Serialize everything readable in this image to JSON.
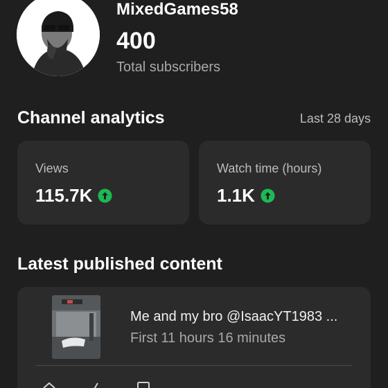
{
  "channel": {
    "name": "MixedGames58",
    "subscriber_count": "400",
    "subscriber_label": "Total subscribers",
    "avatar_icon": "avatar-icon"
  },
  "analytics": {
    "title": "Channel analytics",
    "period": "Last 28 days",
    "cards": [
      {
        "label": "Views",
        "value": "115.7K",
        "trend_icon": "arrow-up-circle-icon",
        "trend_color": "#1db954"
      },
      {
        "label": "Watch time (hours)",
        "value": "1.1K",
        "trend_icon": "arrow-up-circle-icon",
        "trend_color": "#1db954"
      }
    ]
  },
  "latest": {
    "title": "Latest published content",
    "video": {
      "title": "Me and my bro @IsaacYT1983 ...",
      "subtitle": "First 11 hours 16 minutes",
      "stats": [
        {
          "icon": "views-icon",
          "value": ""
        },
        {
          "icon": "like-icon",
          "value": ""
        },
        {
          "icon": "comments-icon",
          "value": ""
        }
      ]
    }
  },
  "colors": {
    "background": "#1f1f1f",
    "card": "#2b2b2b",
    "accent_green": "#1db954",
    "secondary_text": "#a9a9a9"
  }
}
